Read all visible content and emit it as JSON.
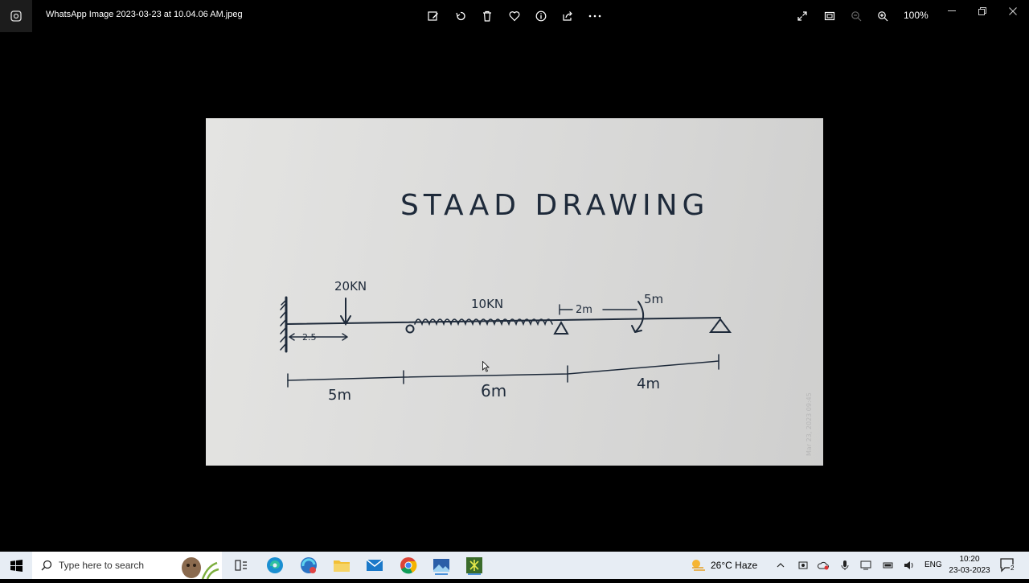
{
  "window": {
    "title": "WhatsApp Image 2023-03-23 at 10.04.06 AM.jpeg",
    "zoom": "100%"
  },
  "toolbar": {
    "items": [
      "edit-image-icon",
      "rotate-icon",
      "delete-icon",
      "favorite-icon",
      "info-icon",
      "share-icon",
      "more-icon"
    ]
  },
  "drawing": {
    "title": "STAAD DRAWING",
    "load_point": "20KN",
    "offset": "2.5",
    "load_udl": "10KN",
    "offset_2": "2m",
    "moment": "5m",
    "spans": [
      "5m",
      "6m",
      "4m"
    ],
    "watermark": "Mar 23, 2023 09:45"
  },
  "taskbar": {
    "search_placeholder": "Type here to search",
    "weather": "26°C  Haze",
    "language": "ENG",
    "time": "10:20",
    "date": "23-03-2023",
    "notification_count": "2"
  }
}
